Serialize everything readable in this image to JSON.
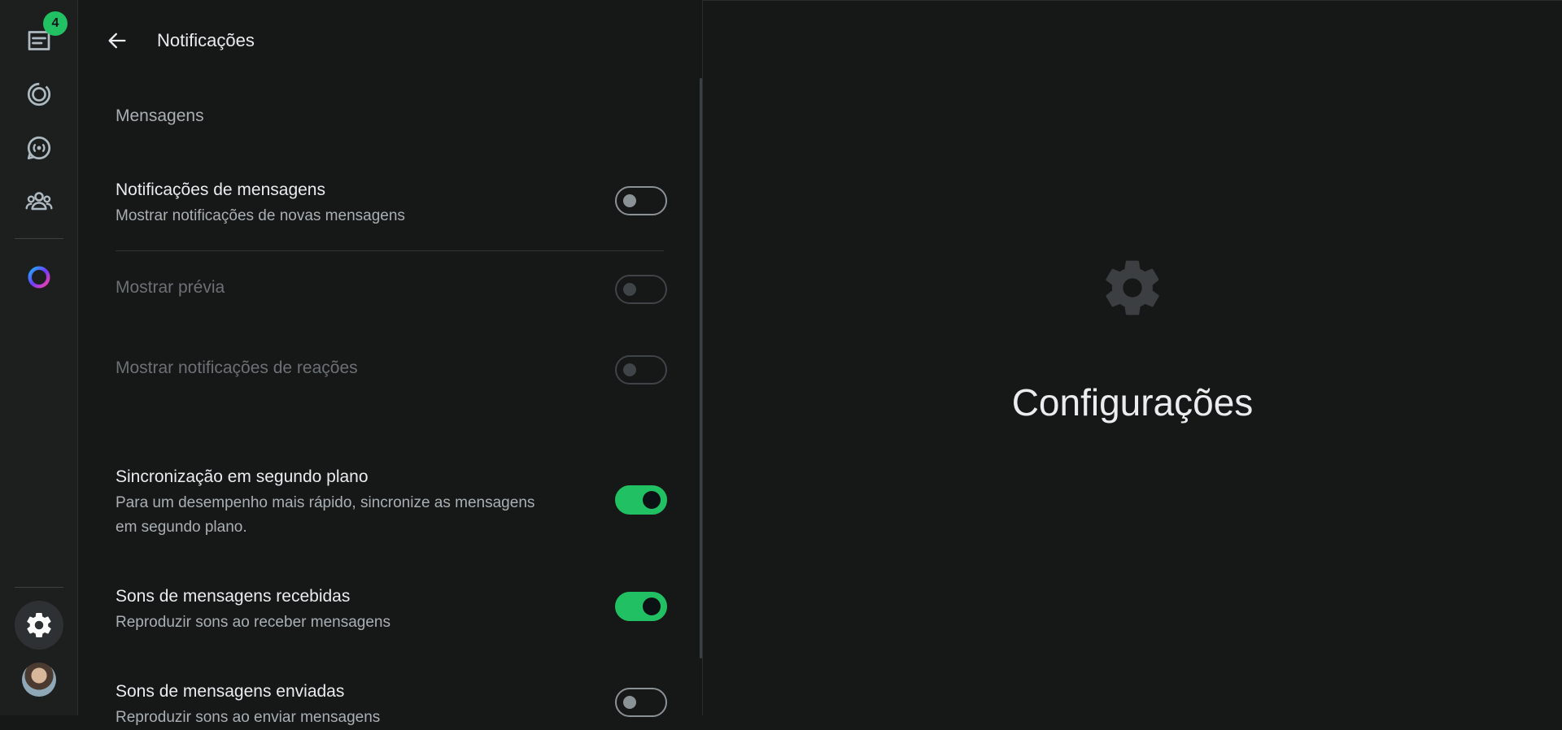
{
  "rail": {
    "chats_badge": "4"
  },
  "panel": {
    "title": "Notificações",
    "section_label": "Mensagens",
    "settings": [
      {
        "title": "Notificações de mensagens",
        "subtitle": "Mostrar notificações de novas mensagens",
        "enabled": false
      },
      {
        "title": "Mostrar prévia",
        "subtitle": "",
        "enabled": false
      },
      {
        "title": "Mostrar notificações de reações",
        "subtitle": "",
        "enabled": false
      },
      {
        "title": "Sincronização em segundo plano",
        "subtitle_line1": "Para um desempenho mais rápido, sincronize as mensagens",
        "subtitle_line2": "em segundo plano.",
        "enabled": true
      },
      {
        "title": "Sons de mensagens recebidas",
        "subtitle": "Reproduzir sons ao receber mensagens",
        "enabled": true
      },
      {
        "title": "Sons de mensagens enviadas",
        "subtitle": "Reproduzir sons ao enviar mensagens",
        "enabled": false
      }
    ]
  },
  "main": {
    "title": "Configurações"
  },
  "colors": {
    "accent": "#21c063",
    "background": "#161717",
    "rail": "#1d1f1f"
  }
}
